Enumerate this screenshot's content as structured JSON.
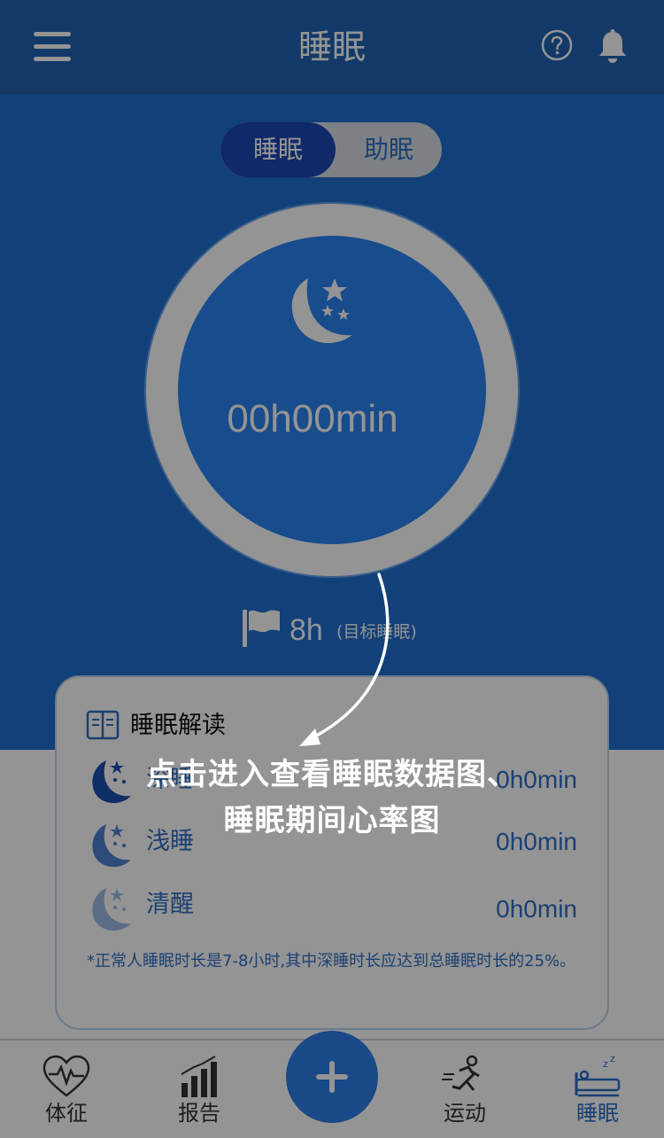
{
  "header": {
    "title": "睡眠",
    "menu_icon": "menu-icon",
    "help_icon": "help-circle-icon",
    "bell_icon": "bell-icon",
    "background": "#1f63b3"
  },
  "toggle": {
    "active_label": "睡眠",
    "inactive_label": "助眠"
  },
  "sleep_summary": {
    "duration": "00h00min",
    "icon": "moon-stars-icon"
  },
  "goal": {
    "value": "8h",
    "label": "(目标睡眠)"
  },
  "interpretation": {
    "title": "睡眠解读",
    "rows": [
      {
        "label": "深睡",
        "value": "0h0min",
        "icon": "moon-star-icon-dark"
      },
      {
        "label": "浅睡",
        "value": "0h0min",
        "icon": "moon-star-icon-medium"
      },
      {
        "label": "清醒",
        "value": "0h0min",
        "icon": "moon-star-icon-light"
      }
    ],
    "note": "*正常人睡眠时长是7-8小时,其中深睡时长应达到总睡眠时长的25%。"
  },
  "bottom_nav": [
    {
      "label": "体征",
      "icon": "heart-pulse-icon"
    },
    {
      "label": "报告",
      "icon": "bar-chart-icon"
    },
    {
      "label": "运动",
      "icon": "running-person-icon"
    },
    {
      "label": "睡眠",
      "icon": "bed-sleep-icon",
      "active": true
    }
  ],
  "add_button": {
    "icon": "plus-icon"
  },
  "overlay": {
    "line1": "点击进入查看睡眠数据图、",
    "line2": "睡眠期间心率图"
  },
  "colors": {
    "accent": "#2a84f2",
    "hero": "#1f6fd0",
    "text_blue": "#2f6fc4"
  }
}
